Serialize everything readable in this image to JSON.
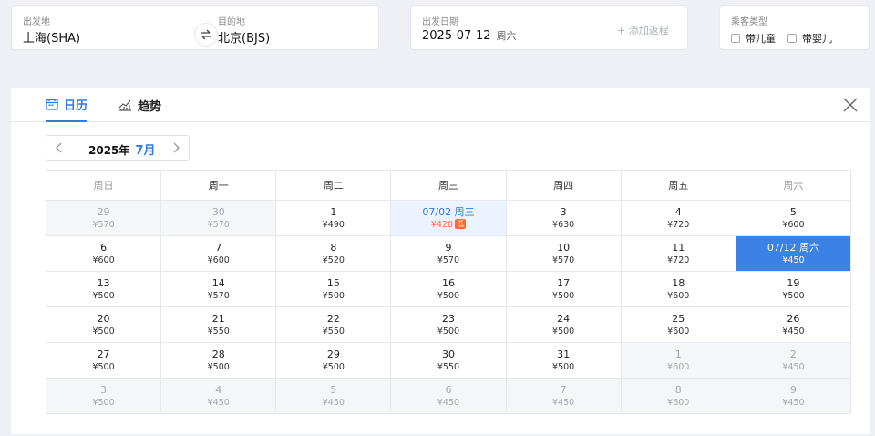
{
  "search": {
    "from_label": "出发地",
    "from_value": "上海(SHA)",
    "to_label": "目的地",
    "to_value": "北京(BJS)",
    "date_label": "出发日期",
    "date_value": "2025-07-12",
    "date_weekday": "周六",
    "add_return": "+ 添加返程",
    "passenger_label": "乘客类型",
    "child_label": "带儿童",
    "infant_label": "带婴儿"
  },
  "tabs": {
    "calendar": "日历",
    "trend": "趋势"
  },
  "month_nav": {
    "year": "2025年",
    "month": "7月"
  },
  "weekdays": [
    "周日",
    "周一",
    "周二",
    "周三",
    "周四",
    "周五",
    "周六"
  ],
  "low_tag": "低",
  "weeks": [
    [
      {
        "day": "29",
        "price": "¥570",
        "state": "out"
      },
      {
        "day": "30",
        "price": "¥570",
        "state": "out"
      },
      {
        "day": "1",
        "price": "¥490",
        "state": ""
      },
      {
        "day": "07/02 周三",
        "price": "¥420",
        "state": "low"
      },
      {
        "day": "3",
        "price": "¥630",
        "state": ""
      },
      {
        "day": "4",
        "price": "¥720",
        "state": ""
      },
      {
        "day": "5",
        "price": "¥600",
        "state": ""
      }
    ],
    [
      {
        "day": "6",
        "price": "¥600",
        "state": ""
      },
      {
        "day": "7",
        "price": "¥600",
        "state": ""
      },
      {
        "day": "8",
        "price": "¥520",
        "state": ""
      },
      {
        "day": "9",
        "price": "¥570",
        "state": ""
      },
      {
        "day": "10",
        "price": "¥570",
        "state": ""
      },
      {
        "day": "11",
        "price": "¥720",
        "state": ""
      },
      {
        "day": "07/12 周六",
        "price": "¥450",
        "state": "sel"
      }
    ],
    [
      {
        "day": "13",
        "price": "¥500",
        "state": ""
      },
      {
        "day": "14",
        "price": "¥570",
        "state": ""
      },
      {
        "day": "15",
        "price": "¥500",
        "state": ""
      },
      {
        "day": "16",
        "price": "¥500",
        "state": ""
      },
      {
        "day": "17",
        "price": "¥500",
        "state": ""
      },
      {
        "day": "18",
        "price": "¥600",
        "state": ""
      },
      {
        "day": "19",
        "price": "¥500",
        "state": ""
      }
    ],
    [
      {
        "day": "20",
        "price": "¥500",
        "state": ""
      },
      {
        "day": "21",
        "price": "¥550",
        "state": ""
      },
      {
        "day": "22",
        "price": "¥550",
        "state": ""
      },
      {
        "day": "23",
        "price": "¥500",
        "state": ""
      },
      {
        "day": "24",
        "price": "¥500",
        "state": ""
      },
      {
        "day": "25",
        "price": "¥600",
        "state": ""
      },
      {
        "day": "26",
        "price": "¥450",
        "state": ""
      }
    ],
    [
      {
        "day": "27",
        "price": "¥500",
        "state": ""
      },
      {
        "day": "28",
        "price": "¥500",
        "state": ""
      },
      {
        "day": "29",
        "price": "¥500",
        "state": ""
      },
      {
        "day": "30",
        "price": "¥550",
        "state": ""
      },
      {
        "day": "31",
        "price": "¥500",
        "state": ""
      },
      {
        "day": "1",
        "price": "¥600",
        "state": "out"
      },
      {
        "day": "2",
        "price": "¥450",
        "state": "out"
      }
    ],
    [
      {
        "day": "3",
        "price": "¥500",
        "state": "out"
      },
      {
        "day": "4",
        "price": "¥450",
        "state": "out"
      },
      {
        "day": "5",
        "price": "¥450",
        "state": "out"
      },
      {
        "day": "6",
        "price": "¥450",
        "state": "out"
      },
      {
        "day": "7",
        "price": "¥450",
        "state": "out"
      },
      {
        "day": "8",
        "price": "¥600",
        "state": "out"
      },
      {
        "day": "9",
        "price": "¥450",
        "state": "out"
      }
    ]
  ],
  "colors": {
    "accent": "#2f7be0",
    "selected_bg": "#3b82e4",
    "low_price": "#ff6d2e",
    "low_bg": "#eaf3fe"
  }
}
